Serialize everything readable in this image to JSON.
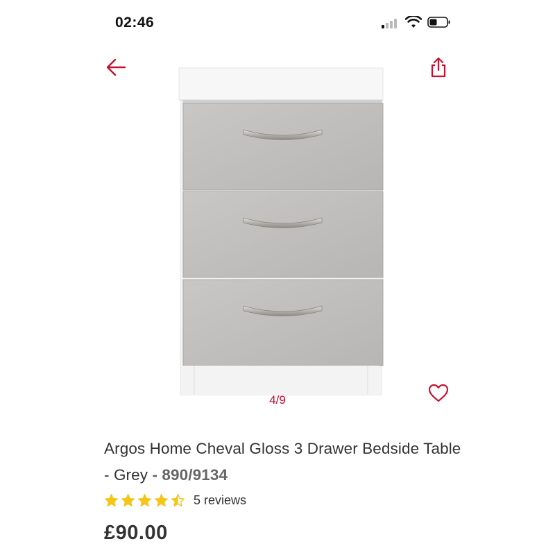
{
  "status_bar": {
    "time": "02:46",
    "icons": [
      "cellular-signal-icon",
      "wifi-icon",
      "battery-icon"
    ]
  },
  "navigation": {
    "back_icon": "arrow-left-icon",
    "share_icon": "share-icon",
    "favourite_icon": "heart-icon"
  },
  "gallery": {
    "counter": "4/9"
  },
  "product": {
    "title": "Argos Home Cheval Gloss 3 Drawer Bedside Table - Grey",
    "sku_separator": " - ",
    "sku": "890/9134",
    "rating": 4.5,
    "rating_max": 5,
    "reviews": "5 reviews",
    "price": "£90.00"
  },
  "colors": {
    "accent": "#c8102e",
    "star": "#f5c518",
    "text": "#333333",
    "nav_bg": "#fdf3f4"
  }
}
